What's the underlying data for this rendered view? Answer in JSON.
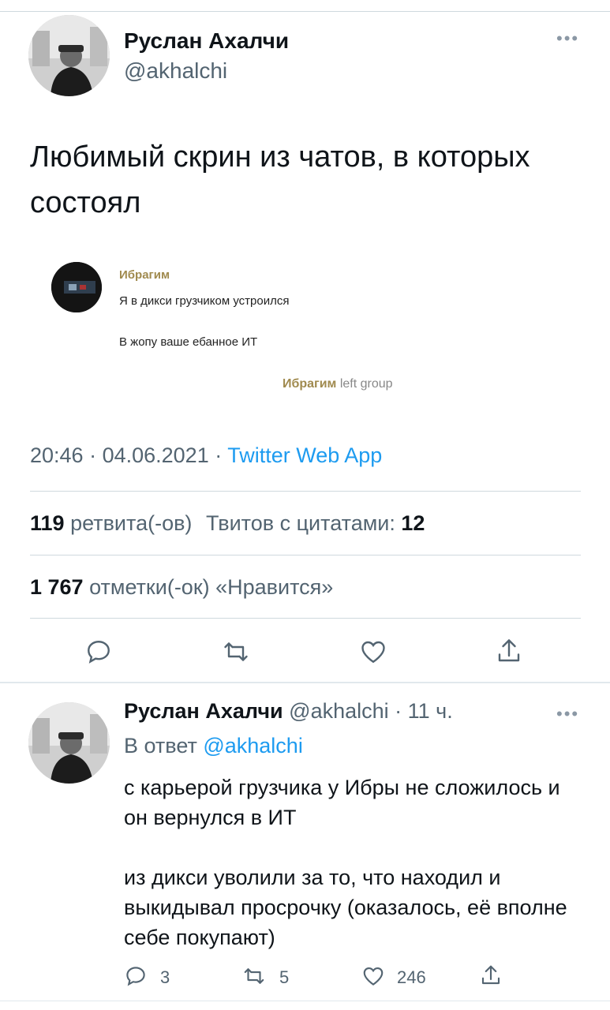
{
  "main_tweet": {
    "author_name": "Руслан Ахалчи",
    "author_handle": "@akhalchi",
    "text": "Любимый скрин из чатов, в которых состоял",
    "embedded_chat": {
      "sender": "Ибрагим",
      "message_1": "Я в дикси грузчиком устроился",
      "message_2": "В жопу ваше ебанное ИТ",
      "event_name": "Ибрагим",
      "event_text": "left group"
    },
    "time": "20:46",
    "date": "04.06.2021",
    "source": "Twitter Web App",
    "retweets_count": "119",
    "retweets_label": "ретвита(-ов)",
    "quotes_label": "Твитов с цитатами:",
    "quotes_count": "12",
    "likes_count": "1 767",
    "likes_label": "отметки(-ок) «Нравится»"
  },
  "reply_tweet": {
    "author_name": "Руслан Ахалчи",
    "author_handle": "@akhalchi",
    "age": "11 ч.",
    "reply_prefix": "В ответ",
    "reply_to": "@akhalchi",
    "paragraph_1": "с карьерой грузчика у Ибры не сложилось и он вернулся в ИТ",
    "paragraph_2": "из дикси уволили за то, что находил и выкидывал просрочку (оказалось, её вполне себе покупают)",
    "reply_count": "3",
    "retweet_count": "5",
    "like_count": "246"
  },
  "icons": [
    "more-icon",
    "reply-icon",
    "retweet-icon",
    "like-icon",
    "share-icon"
  ],
  "colors": {
    "accent": "#1d9bf0",
    "secondary_text": "#536471",
    "chat_name": "#a08a4e"
  }
}
